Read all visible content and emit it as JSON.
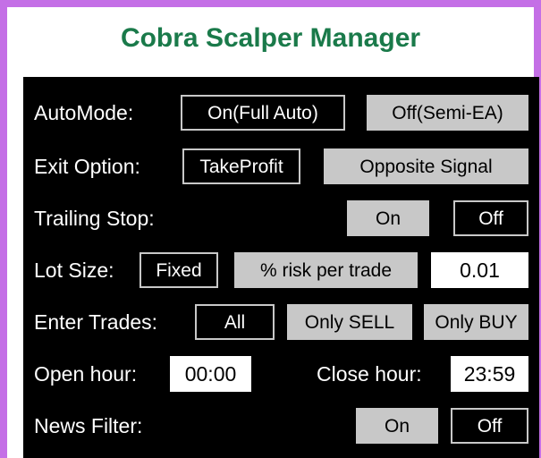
{
  "title": "Cobra Scalper Manager",
  "rows": {
    "automode": {
      "label": "AutoMode:",
      "on": "On(Full Auto)",
      "off": "Off(Semi-EA)",
      "selected": "on"
    },
    "exit": {
      "label": "Exit Option:",
      "takeprofit": "TakeProfit",
      "opposite": "Opposite Signal",
      "selected": "takeprofit"
    },
    "trailing": {
      "label": "Trailing Stop:",
      "on": "On",
      "off": "Off",
      "selected": "off"
    },
    "lot": {
      "label": "Lot Size:",
      "fixed": "Fixed",
      "risk": "% risk per trade",
      "value": "0.01",
      "selected": "fixed"
    },
    "enter": {
      "label": "Enter Trades:",
      "all": "All",
      "sell": "Only SELL",
      "buy": "Only BUY",
      "selected": "all"
    },
    "hours": {
      "open_label": "Open hour:",
      "open_value": "00:00",
      "close_label": "Close hour:",
      "close_value": "23:59"
    },
    "news": {
      "label": "News Filter:",
      "on": "On",
      "off": "Off",
      "selected": "off"
    }
  },
  "colors": {
    "frame": "#c46fe6",
    "title": "#1a7a4a",
    "panel": "#000000",
    "button_inactive": "#c8c8c8",
    "button_active": "#000000"
  }
}
